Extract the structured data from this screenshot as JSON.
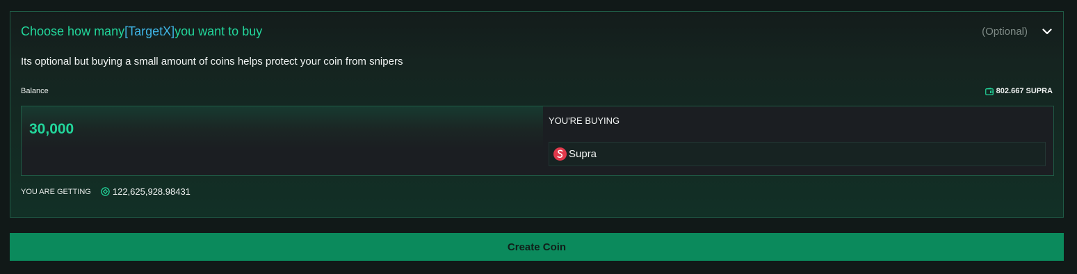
{
  "section": {
    "title_prefix": "Choose how many",
    "title_token": "[TargetX]",
    "title_suffix": "you want to buy",
    "optional_label": "(Optional)",
    "description": "Its optional but buying a small amount of coins helps protect your coin from snipers"
  },
  "balance": {
    "label": "Balance",
    "value": "802.667 SUPRA"
  },
  "input": {
    "amount": "30,000",
    "buying_label": "YOU'RE BUYING",
    "coin_name": "Supra"
  },
  "getting": {
    "label": "YOU ARE GETTING",
    "value": "122,625,928.98431"
  },
  "actions": {
    "create_label": "Create Coin"
  },
  "colors": {
    "accent": "#22d69b",
    "token": "#3fb5e6",
    "button": "#0b8a5c",
    "coin_logo": "#e0394b"
  }
}
